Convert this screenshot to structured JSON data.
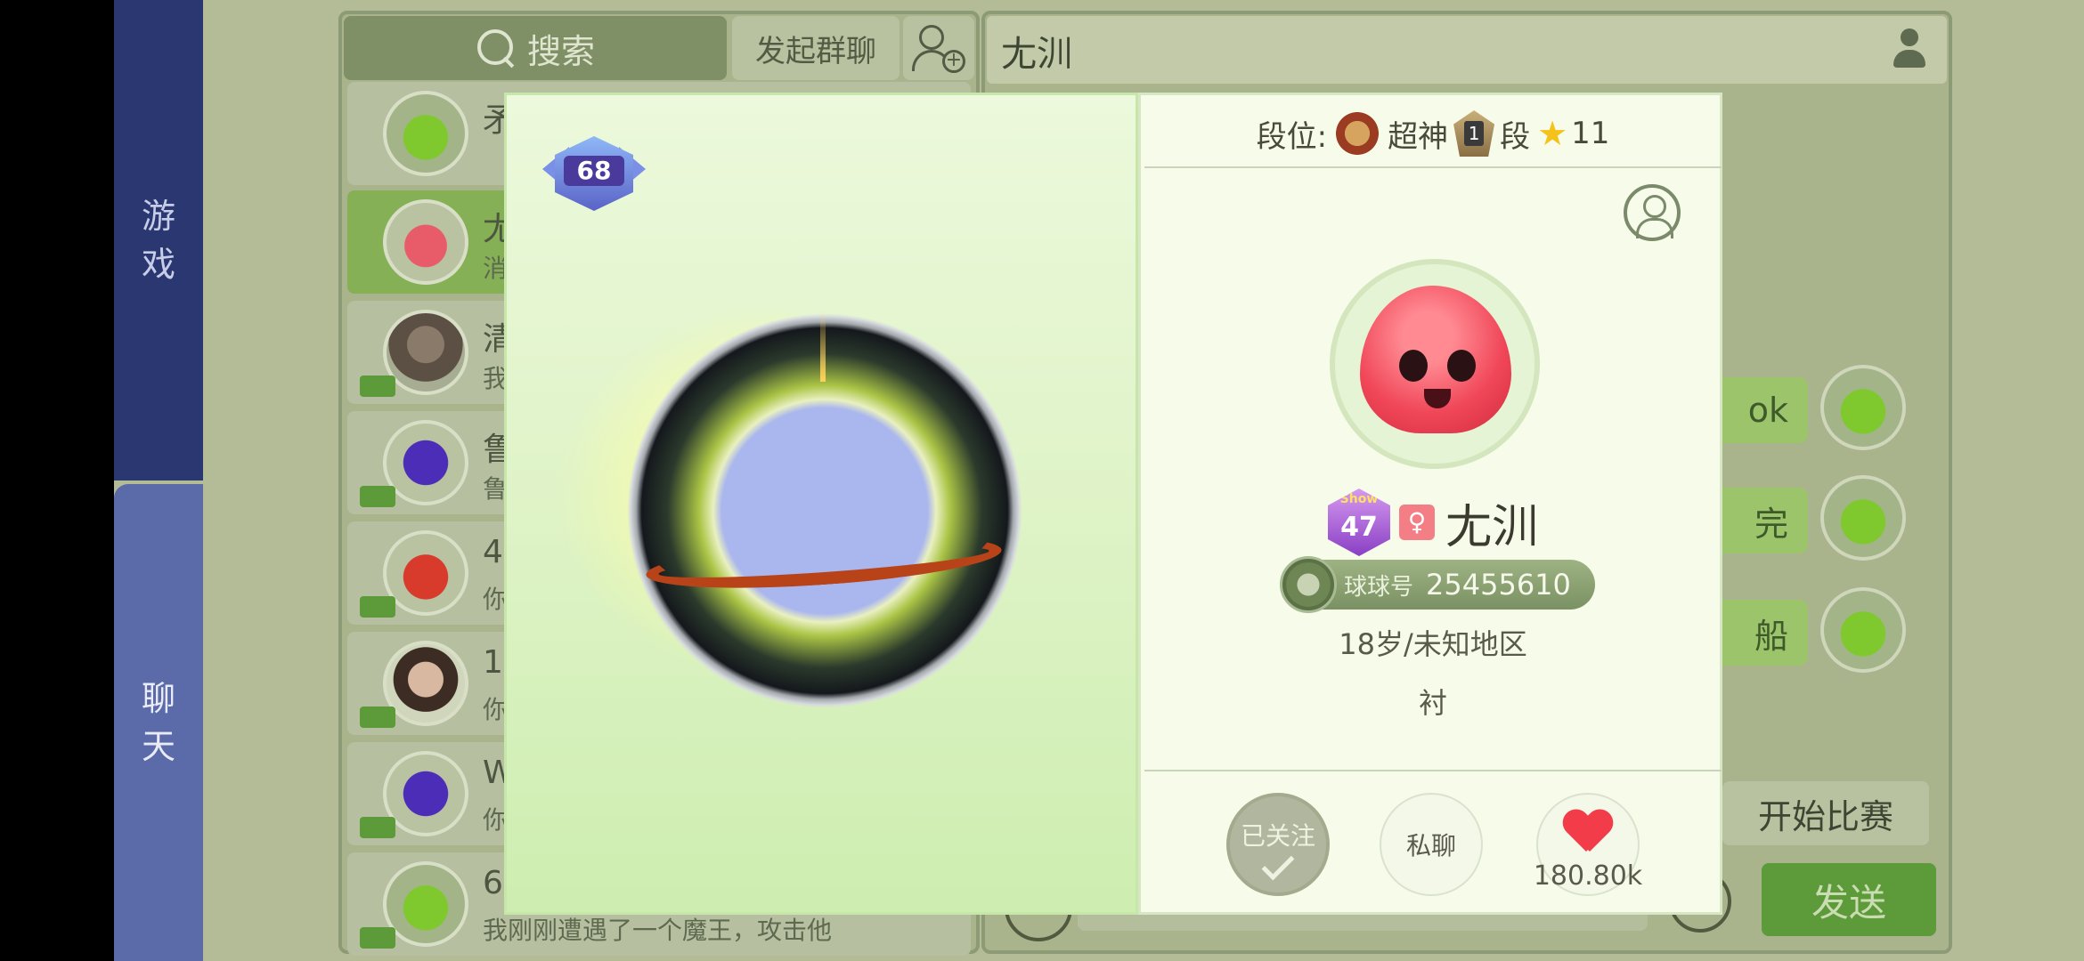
{
  "sidebar": {
    "tab_game": [
      "游",
      "戏"
    ],
    "tab_chat": [
      "聊",
      "天"
    ]
  },
  "list_panel": {
    "search_label": "搜索",
    "group_chat_label": "发起群聊",
    "items": [
      {
        "name": "矛",
        "msg": ""
      },
      {
        "name": "尢",
        "msg": "消"
      },
      {
        "name": "清",
        "msg": "我"
      },
      {
        "name": "鲁",
        "msg": "鲁"
      },
      {
        "name": "4",
        "msg": "你"
      },
      {
        "name": "1",
        "msg": "你"
      },
      {
        "name": "W",
        "msg": "你"
      },
      {
        "name": "6",
        "msg": "我刚刚遭遇了一个魔王，攻击他"
      }
    ]
  },
  "chat_panel": {
    "title": "尢汌",
    "bubbles": [
      "ok",
      "完",
      "船"
    ],
    "start_match_label": "开始比赛",
    "send_label": "发送"
  },
  "profile": {
    "level": "68",
    "rank_label": "段位:",
    "rank_title": "超神",
    "rank_medal_number": "1",
    "rank_tier_suffix": "段",
    "rank_stars": "11",
    "show_label": "Show",
    "show_level": "47",
    "gender_symbol": "♀",
    "nickname": "尢汌",
    "qq_id_label": "球球号",
    "qq_id": "25455610",
    "age_region": "18岁/未知地区",
    "signature": "衬",
    "followed_label": "已关注",
    "private_chat_label": "私聊",
    "likes": "180.80k"
  }
}
